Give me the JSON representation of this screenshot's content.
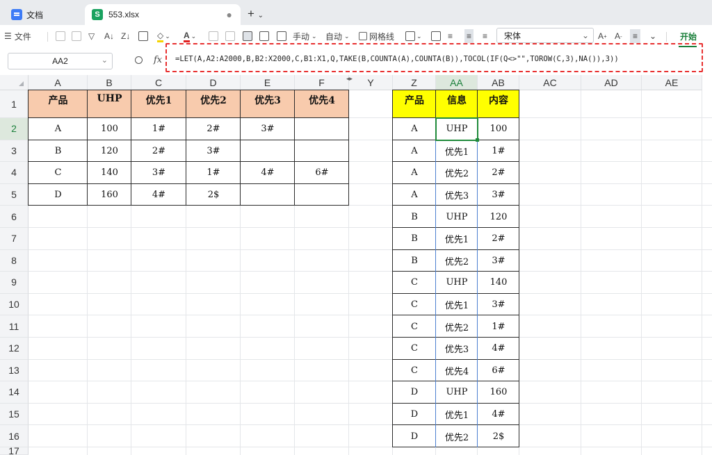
{
  "tabs": [
    {
      "label": "文档",
      "active": false
    },
    {
      "label": "553.xlsx",
      "active": true
    }
  ],
  "toolbar": {
    "file_label": "文件",
    "manual_label": "手动",
    "auto_label": "自动",
    "gridlines_label": "网格线",
    "font_name": "宋体",
    "start_label": "开始"
  },
  "formula_bar": {
    "name_box": "AA2",
    "fx": "fx",
    "formula": "=LET(A,A2:A2000,B,B2:X2000,C,B1:X1,Q,TAKE(B,COUNTA(A),COUNTA(B)),TOCOL(IF(Q<>\"\",TOROW(C,3),NA()),3))"
  },
  "columns": [
    "A",
    "B",
    "C",
    "D",
    "E",
    "F",
    "Y",
    "Z",
    "AA",
    "AB",
    "AC",
    "AD",
    "AE"
  ],
  "selected_column": "AA",
  "rows": [
    "1",
    "2",
    "3",
    "4",
    "5",
    "6",
    "7",
    "8",
    "9",
    "10",
    "11",
    "12",
    "13",
    "14",
    "15",
    "16",
    "17"
  ],
  "selected_row": "2",
  "source_table": {
    "headers": [
      "产品",
      "UHP",
      "优先1",
      "优先2",
      "优先3",
      "优先4"
    ],
    "rows": [
      [
        "A",
        "100",
        "1#",
        "2#",
        "3#",
        ""
      ],
      [
        "B",
        "120",
        "2#",
        "3#",
        "",
        ""
      ],
      [
        "C",
        "140",
        "3#",
        "1#",
        "4#",
        "6#"
      ],
      [
        "D",
        "160",
        "4#",
        "2$",
        "",
        ""
      ]
    ]
  },
  "result_table": {
    "headers": [
      "产品",
      "信息",
      "内容"
    ],
    "rows": [
      [
        "A",
        "UHP",
        "100"
      ],
      [
        "A",
        "优先1",
        "1#"
      ],
      [
        "A",
        "优先2",
        "2#"
      ],
      [
        "A",
        "优先3",
        "3#"
      ],
      [
        "B",
        "UHP",
        "120"
      ],
      [
        "B",
        "优先1",
        "2#"
      ],
      [
        "B",
        "优先2",
        "3#"
      ],
      [
        "C",
        "UHP",
        "140"
      ],
      [
        "C",
        "优先1",
        "3#"
      ],
      [
        "C",
        "优先2",
        "1#"
      ],
      [
        "C",
        "优先3",
        "4#"
      ],
      [
        "C",
        "优先4",
        "6#"
      ],
      [
        "D",
        "UHP",
        "160"
      ],
      [
        "D",
        "优先1",
        "4#"
      ],
      [
        "D",
        "优先2",
        "2$"
      ]
    ]
  },
  "colors": {
    "source_header_fill": "#f8cbad",
    "result_header_fill": "#ffff00",
    "selection": "#1f8a3a",
    "formula_highlight": "#e83030"
  }
}
